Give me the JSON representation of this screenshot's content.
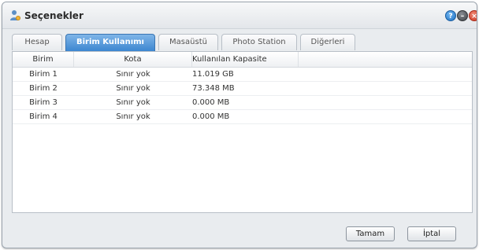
{
  "window": {
    "title": "Seçenekler",
    "help_glyph": "?",
    "min_glyph": "–",
    "close_glyph": "×"
  },
  "tabs": [
    {
      "label": "Hesap",
      "active": false
    },
    {
      "label": "Birim Kullanımı",
      "active": true
    },
    {
      "label": "Masaüstü",
      "active": false
    },
    {
      "label": "Photo Station",
      "active": false
    },
    {
      "label": "Diğerleri",
      "active": false
    }
  ],
  "table": {
    "columns": [
      "Birim",
      "Kota",
      "Kullanılan Kapasite"
    ],
    "rows": [
      [
        "Birim 1",
        "Sınır yok",
        "11.019 GB"
      ],
      [
        "Birim 2",
        "Sınır yok",
        "73.348 MB"
      ],
      [
        "Birim 3",
        "Sınır yok",
        "0.000 MB"
      ],
      [
        "Birim 4",
        "Sınır yok",
        "0.000 MB"
      ]
    ]
  },
  "footer": {
    "ok_label": "Tamam",
    "cancel_label": "İptal"
  },
  "colors": {
    "active_tab": "#3c86d0",
    "close_button": "#c8321e",
    "help_button": "#1f6fc0"
  }
}
